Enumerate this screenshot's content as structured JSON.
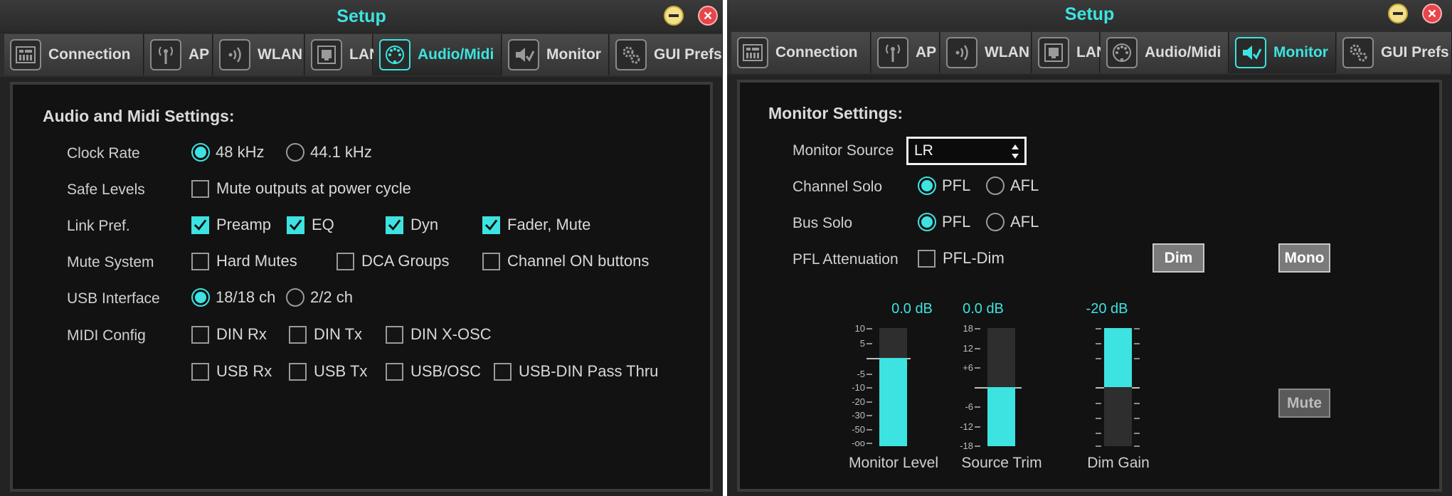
{
  "left": {
    "title": "Setup",
    "tabs": [
      {
        "label": "Connection",
        "icon": "connection-icon"
      },
      {
        "label": "AP",
        "icon": "antenna-icon"
      },
      {
        "label": "WLAN",
        "icon": "wlan-icon"
      },
      {
        "label": "LAN",
        "icon": "lan-port-icon"
      },
      {
        "label": "Audio/Midi",
        "icon": "midi-din-icon"
      },
      {
        "label": "Monitor",
        "icon": "monitor-speaker-icon"
      },
      {
        "label": "GUI Prefs",
        "icon": "gears-icon"
      }
    ],
    "active_tab": "Audio/Midi",
    "section_title": "Audio and Midi Settings:",
    "rows": {
      "clock_rate": {
        "label": "Clock Rate",
        "opt1": "48 kHz",
        "opt2": "44.1 kHz",
        "selected": "48 kHz"
      },
      "safe_levels": {
        "label": "Safe Levels",
        "opt1": "Mute outputs at power cycle"
      },
      "link_pref": {
        "label": "Link Pref.",
        "opt1": "Preamp",
        "opt2": "EQ",
        "opt3": "Dyn",
        "opt4": "Fader, Mute"
      },
      "mute_system": {
        "label": "Mute System",
        "opt1": "Hard Mutes",
        "opt2": "DCA Groups",
        "opt3": "Channel ON buttons"
      },
      "usb_interface": {
        "label": "USB Interface",
        "opt1": "18/18 ch",
        "opt2": "2/2 ch",
        "selected": "18/18 ch"
      },
      "midi_config": {
        "label": "MIDI Config",
        "opt1": "DIN Rx",
        "opt2": "DIN Tx",
        "opt3": "DIN X-OSC",
        "opt4": "USB Rx",
        "opt5": "USB Tx",
        "opt6": "USB/OSC",
        "opt7": "USB-DIN Pass Thru"
      }
    }
  },
  "right": {
    "title": "Setup",
    "tabs": [
      {
        "label": "Connection",
        "icon": "connection-icon"
      },
      {
        "label": "AP",
        "icon": "antenna-icon"
      },
      {
        "label": "WLAN",
        "icon": "wlan-icon"
      },
      {
        "label": "LAN",
        "icon": "lan-port-icon"
      },
      {
        "label": "Audio/Midi",
        "icon": "midi-din-icon"
      },
      {
        "label": "Monitor",
        "icon": "monitor-speaker-icon"
      },
      {
        "label": "GUI Prefs",
        "icon": "gears-icon"
      }
    ],
    "active_tab": "Monitor",
    "section_title": "Monitor Settings:",
    "monitor_source": {
      "label": "Monitor Source",
      "value": "LR"
    },
    "channel_solo": {
      "label": "Channel Solo",
      "opt1": "PFL",
      "opt2": "AFL",
      "selected": "PFL"
    },
    "bus_solo": {
      "label": "Bus Solo",
      "opt1": "PFL",
      "opt2": "AFL",
      "selected": "PFL"
    },
    "pfl_attenuation": {
      "label": "PFL Attenuation",
      "opt1": "PFL-Dim"
    },
    "buttons": {
      "dim": "Dim",
      "mono": "Mono",
      "mute": "Mute"
    },
    "meters": {
      "monitor_level": {
        "name": "Monitor Level",
        "value": "0.0 dB",
        "scale": [
          "10",
          "5",
          "-5",
          "-10",
          "-20",
          "-30",
          "-50",
          "-oo"
        ]
      },
      "source_trim": {
        "name": "Source Trim",
        "value": "0.0 dB",
        "scale": [
          "18",
          "12",
          "+6",
          "-6",
          "-12",
          "-18"
        ]
      },
      "dim_gain": {
        "name": "Dim Gain",
        "value": "-20 dB"
      }
    }
  },
  "colors": {
    "accent": "#3de3e0",
    "panel": "#121212",
    "chrome": "#2d2d2d"
  }
}
